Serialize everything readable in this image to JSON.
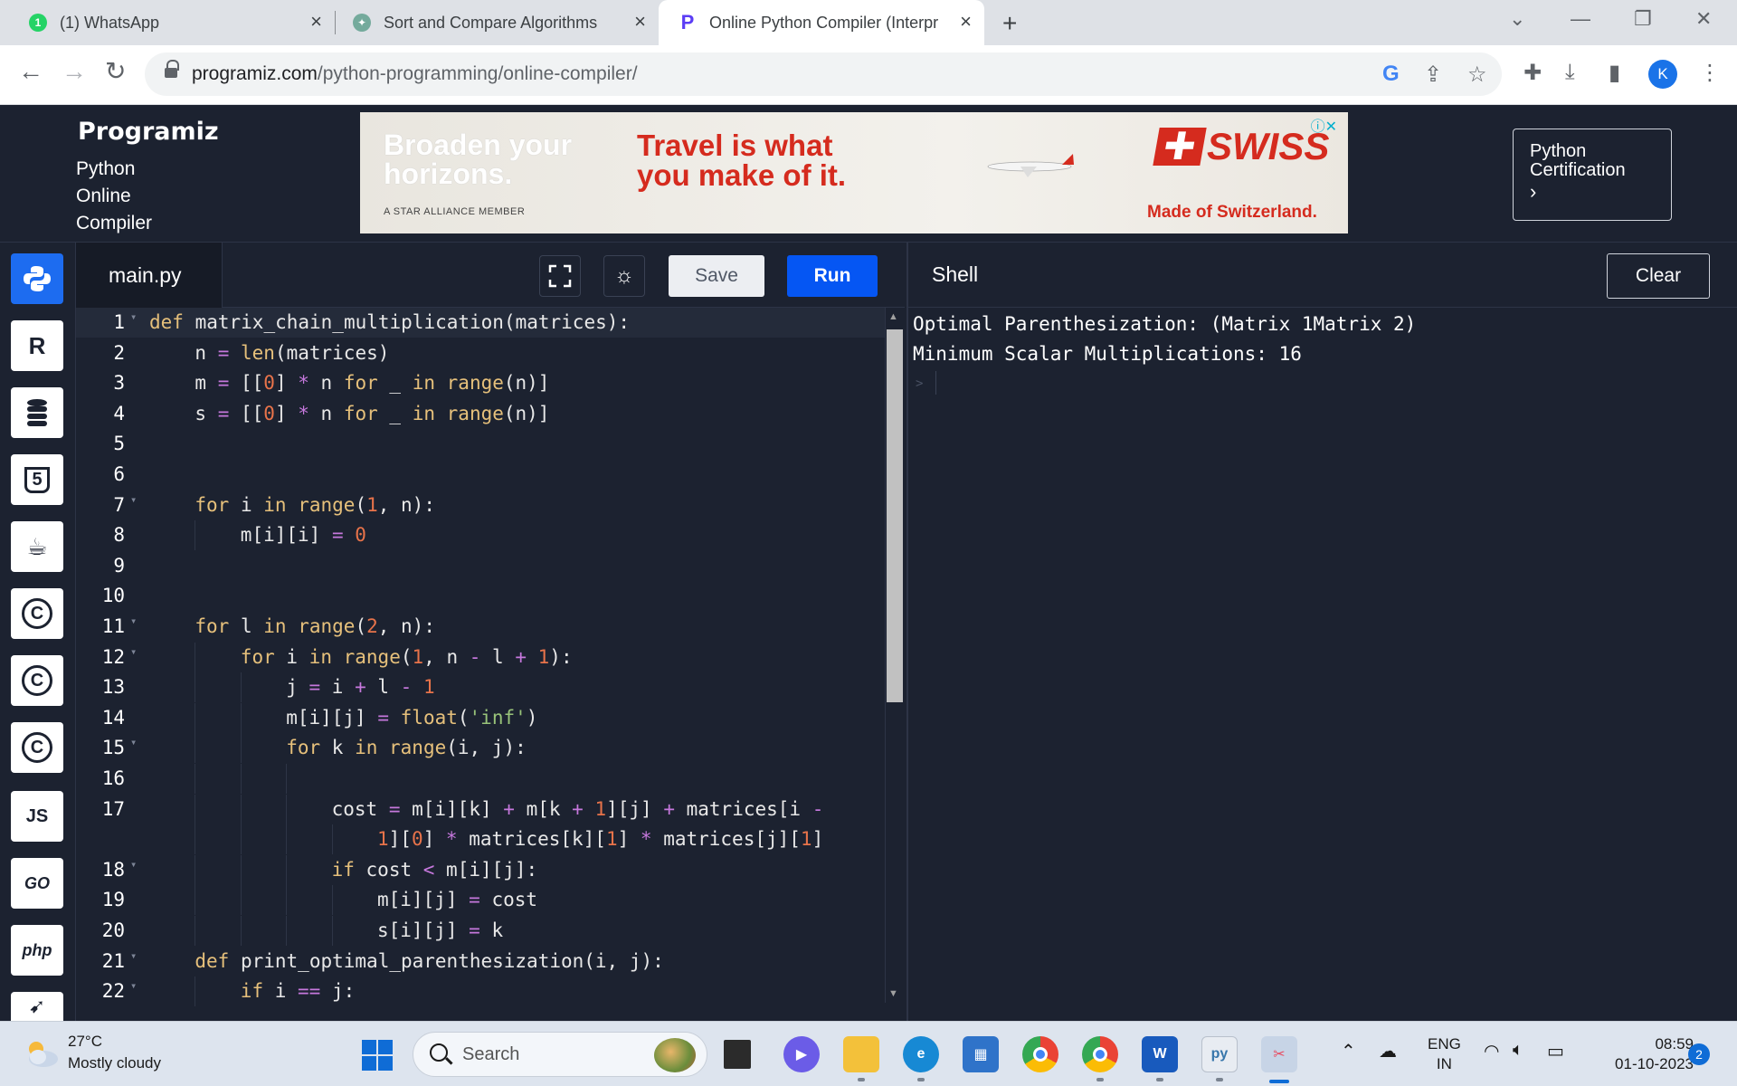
{
  "browser": {
    "tabs": [
      {
        "title": "(1) WhatsApp",
        "badge": "1",
        "favicon_color": "#25d366",
        "active": false
      },
      {
        "title": "Sort and Compare Algorithms",
        "favicon_color": "#74aa9c",
        "active": false
      },
      {
        "title": "Online Python Compiler (Interpr",
        "favicon_color": "#5b3df5",
        "active": true
      }
    ],
    "url_host": "programiz.com",
    "url_path": "/python-programming/online-compiler/",
    "profile_initial": "K"
  },
  "header": {
    "logo": "Programiz",
    "subtitle": "Python\nOnline\nCompiler",
    "cert_label": "Python Certification",
    "cert_arrow": "›"
  },
  "ad": {
    "line1": "Broaden your\nhorizons.",
    "star": "A STAR ALLIANCE MEMBER",
    "line2": "Travel is what\nyou make of it.",
    "brand": "SWISS",
    "tagline": "Made of Switzerland.",
    "accent": "#d52b1e"
  },
  "languages": [
    {
      "name": "python",
      "label": "",
      "active": true
    },
    {
      "name": "r",
      "label": "R"
    },
    {
      "name": "sql",
      "label": ""
    },
    {
      "name": "html",
      "label": "5"
    },
    {
      "name": "java",
      "label": "☕"
    },
    {
      "name": "c",
      "label": "C"
    },
    {
      "name": "cpp",
      "label": "C"
    },
    {
      "name": "csharp",
      "label": "C"
    },
    {
      "name": "js",
      "label": "JS"
    },
    {
      "name": "go",
      "label": "GO"
    },
    {
      "name": "php",
      "label": "php"
    },
    {
      "name": "swift",
      "label": ""
    }
  ],
  "editor": {
    "filename": "main.py",
    "save_label": "Save",
    "run_label": "Run"
  },
  "code_lines": [
    {
      "n": "1",
      "fold": true,
      "html": "<span class=\"kw\">def</span> matrix_chain_multiplication(matrices):",
      "indent": 0,
      "cur": true
    },
    {
      "n": "2",
      "html": "n <span class=\"op\">=</span> <span class=\"bi\">len</span>(matrices)",
      "indent": 1
    },
    {
      "n": "3",
      "html": "m <span class=\"op\">=</span> [[<span class=\"num\">0</span>] <span class=\"op\">*</span> n <span class=\"kw\">for</span> _ <span class=\"kw\">in</span> <span class=\"bi\">range</span>(n)]",
      "indent": 1
    },
    {
      "n": "4",
      "html": "s <span class=\"op\">=</span> [[<span class=\"num\">0</span>] <span class=\"op\">*</span> n <span class=\"kw\">for</span> _ <span class=\"kw\">in</span> <span class=\"bi\">range</span>(n)]",
      "indent": 1
    },
    {
      "n": "5",
      "html": "",
      "indent": 0
    },
    {
      "n": "6",
      "html": "",
      "indent": 0
    },
    {
      "n": "7",
      "fold": true,
      "html": "<span class=\"kw\">for</span> i <span class=\"kw\">in</span> <span class=\"bi\">range</span>(<span class=\"num\">1</span>, n):",
      "indent": 1
    },
    {
      "n": "8",
      "html": "m[i][i] <span class=\"op\">=</span> <span class=\"num\">0</span>",
      "indent": 2
    },
    {
      "n": "9",
      "html": "",
      "indent": 0
    },
    {
      "n": "10",
      "html": "",
      "indent": 0
    },
    {
      "n": "11",
      "fold": true,
      "html": "<span class=\"kw\">for</span> l <span class=\"kw\">in</span> <span class=\"bi\">range</span>(<span class=\"num\">2</span>, n):",
      "indent": 1
    },
    {
      "n": "12",
      "fold": true,
      "html": "<span class=\"kw\">for</span> i <span class=\"kw\">in</span> <span class=\"bi\">range</span>(<span class=\"num\">1</span>, n <span class=\"op\">-</span> l <span class=\"op\">+</span> <span class=\"num\">1</span>):",
      "indent": 2
    },
    {
      "n": "13",
      "html": "j <span class=\"op\">=</span> i <span class=\"op\">+</span> l <span class=\"op\">-</span> <span class=\"num\">1</span>",
      "indent": 3
    },
    {
      "n": "14",
      "html": "m[i][j] <span class=\"op\">=</span> <span class=\"bi\">float</span>(<span class=\"str\">'inf'</span>)",
      "indent": 3
    },
    {
      "n": "15",
      "fold": true,
      "html": "<span class=\"kw\">for</span> k <span class=\"kw\">in</span> <span class=\"bi\">range</span>(i, j):",
      "indent": 3
    },
    {
      "n": "16",
      "html": "",
      "indent": 4
    },
    {
      "n": "17",
      "html": "cost <span class=\"op\">=</span> m[i][k] <span class=\"op\">+</span> m[k <span class=\"op\">+</span> <span class=\"num\">1</span>][j] <span class=\"op\">+</span> matrices[i <span class=\"op\">-</span>",
      "indent": 4
    },
    {
      "n": "",
      "html": "<span class=\"num\">1</span>][<span class=\"num\">0</span>] <span class=\"op\">*</span> matrices[k][<span class=\"num\">1</span>] <span class=\"op\">*</span> matrices[j][<span class=\"num\">1</span>]",
      "indent": 5
    },
    {
      "n": "18",
      "fold": true,
      "html": "<span class=\"kw\">if</span> cost <span class=\"op\">&lt;</span> m[i][j]:",
      "indent": 4
    },
    {
      "n": "19",
      "html": "m[i][j] <span class=\"op\">=</span> cost",
      "indent": 5
    },
    {
      "n": "20",
      "html": "s[i][j] <span class=\"op\">=</span> k",
      "indent": 5
    },
    {
      "n": "21",
      "fold": true,
      "html": "<span class=\"kw\">def</span> print_optimal_parenthesization(i, j):",
      "indent": 1
    },
    {
      "n": "22",
      "fold": true,
      "html": "<span class=\"kw\">if</span> i <span class=\"op\">==</span> j:",
      "indent": 2
    }
  ],
  "shell": {
    "title": "Shell",
    "clear_label": "Clear",
    "output": [
      "Optimal Parenthesization: (Matrix 1Matrix 2)",
      "Minimum Scalar Multiplications: 16"
    ],
    "prompt": ">"
  },
  "taskbar": {
    "temperature": "27°C",
    "weather": "Mostly cloudy",
    "search_placeholder": "Search",
    "lang_line1": "ENG",
    "lang_line2": "IN",
    "time": "08:59",
    "date": "01-10-2023",
    "notifications": "2"
  }
}
